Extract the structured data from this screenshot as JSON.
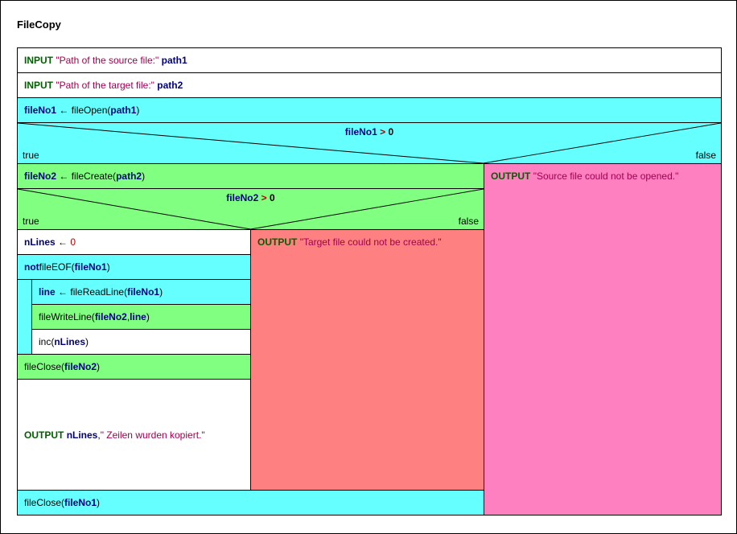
{
  "title": "FileCopy",
  "input1": {
    "kw": "INPUT",
    "prompt": "\"Path of the source file:\"",
    "var": "path1"
  },
  "input2": {
    "kw": "INPUT",
    "prompt": "\"Path of the target file:\"",
    "var": "path2"
  },
  "assign1": {
    "lhs": "fileNo1",
    "arrow": "←",
    "fn": "fileOpen(",
    "arg": "path1",
    "close": ")"
  },
  "cond1": {
    "lhs": "fileNo1",
    "op": " > ",
    "rhs": "0",
    "true": "true",
    "false": "false"
  },
  "falseBranch1": {
    "kw": "OUTPUT",
    "msg": "\"Source file could not be opened.\""
  },
  "assign2": {
    "lhs": "fileNo2",
    "arrow": "←",
    "fn": "fileCreate(",
    "arg": "path2",
    "close": ")"
  },
  "cond2": {
    "lhs": "fileNo2",
    "op": " > ",
    "rhs": "0",
    "true": "true",
    "false": "false"
  },
  "falseBranch2": {
    "kw": "OUTPUT",
    "msg": "\"Target file could not be created.\""
  },
  "initLines": {
    "lhs": "nLines",
    "arrow": "←",
    "rhs": "0"
  },
  "loopCond": {
    "pre": "not",
    "fn": " fileEOF(",
    "arg": "fileNo1",
    "close": ")"
  },
  "readLine": {
    "lhs": "line",
    "arrow": "←",
    "fn": "fileReadLine(",
    "arg": "fileNo1",
    "close": ")"
  },
  "writeLine": {
    "fn": "fileWriteLine(",
    "a1": "fileNo2",
    "sep": ", ",
    "a2": "line",
    "close": ")"
  },
  "incLines": {
    "fn": "inc(",
    "arg": "nLines",
    "close": ")"
  },
  "close2": {
    "fn": "fileClose(",
    "arg": "fileNo2",
    "close": ")"
  },
  "finalOut": {
    "kw": "OUTPUT",
    "var": "nLines",
    "sep": ",",
    "msg": " \" Zeilen wurden kopiert.\""
  },
  "close1": {
    "fn": "fileClose(",
    "arg": "fileNo1",
    "close": ")"
  }
}
